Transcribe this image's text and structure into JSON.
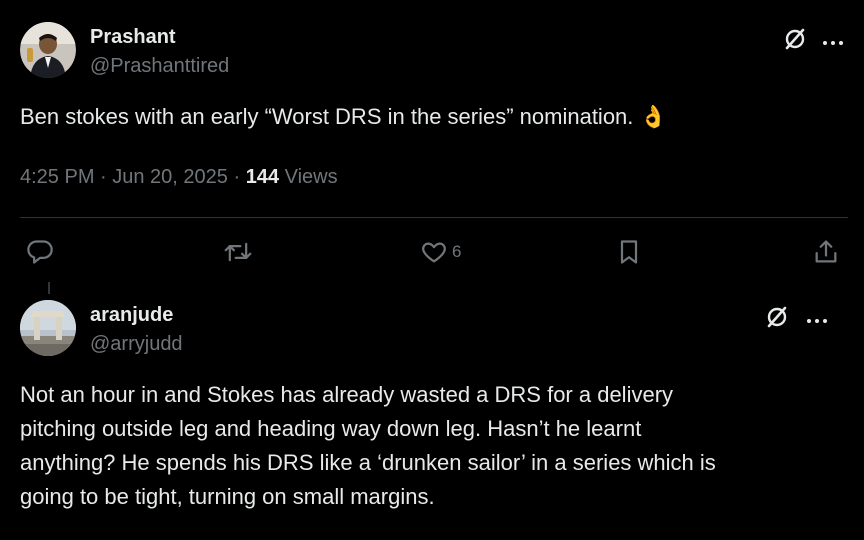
{
  "post": {
    "author_name": "Prashant",
    "author_handle": "@Prashanttired",
    "text": "Ben stokes with an early “Worst DRS in the series” nomination. 👌",
    "time": "4:25 PM · Jun 20, 2025 · ",
    "views_count": "144",
    "views_label": " Views",
    "actions": {
      "reply_icon": "reply-icon",
      "repost_icon": "repost-icon",
      "like_icon": "heart-icon",
      "like_count": "6",
      "bookmark_icon": "bookmark-icon",
      "share_icon": "share-icon"
    },
    "more_label": "···"
  },
  "reply": {
    "author_name": "aranjude",
    "author_handle": "@arryjudd",
    "lines": [
      "Not an hour in and Stokes has already wasted a DRS for a delivery",
      "pitching outside leg and heading way down leg. Hasn’t he learnt",
      "anything? He spends his DRS like a ‘drunken sailor’ in a series which is",
      "going to be tight, turning on small margins."
    ],
    "more_label": "···"
  },
  "colors": {
    "background": "#000000",
    "primary_text": "#e7e9ea",
    "secondary_text": "#71767b",
    "divider": "#2f3336"
  }
}
